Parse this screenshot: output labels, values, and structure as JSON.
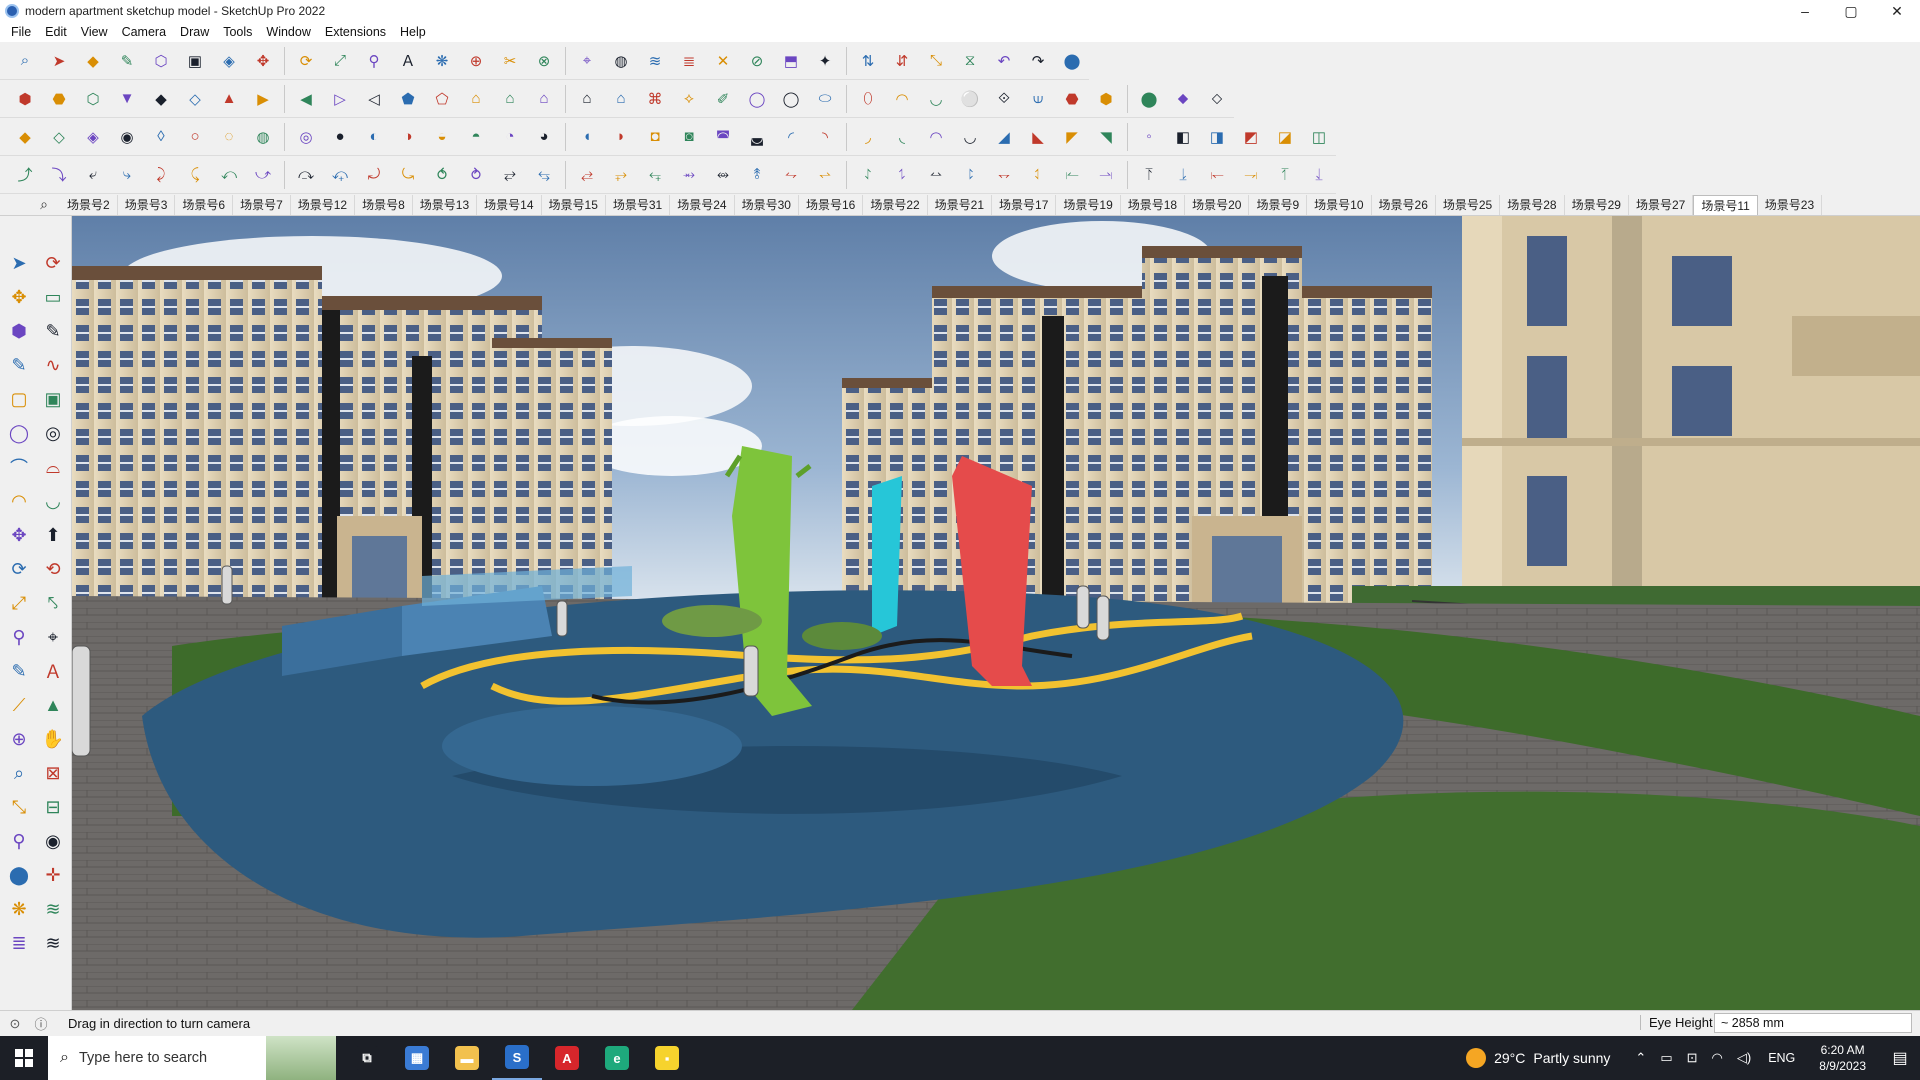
{
  "window": {
    "title": "modern apartment sketchup model - SketchUp Pro 2022",
    "controls": {
      "minimize": "–",
      "maximize": "▢",
      "close": "✕"
    }
  },
  "menu": [
    "File",
    "Edit",
    "View",
    "Camera",
    "Draw",
    "Tools",
    "Window",
    "Extensions",
    "Help"
  ],
  "scenes": {
    "tabs": [
      "场景号2",
      "场景号3",
      "场景号6",
      "场景号7",
      "场景号12",
      "场景号8",
      "场景号13",
      "场景号14",
      "场景号15",
      "场景号31",
      "场景号24",
      "场景号30",
      "场景号16",
      "场景号22",
      "场景号21",
      "场景号17",
      "场景号19",
      "场景号18",
      "场景号20",
      "场景号9",
      "场景号10",
      "场景号26",
      "场景号25",
      "场景号28",
      "场景号29",
      "场景号27",
      "场景号11",
      "场景号23"
    ],
    "active": "场景号11"
  },
  "status": {
    "message": "Drag in direction to turn camera",
    "eye_height_label": "Eye Height",
    "eye_height_value": "~ 2858 mm"
  },
  "taskbar": {
    "search_placeholder": "Type here to search",
    "apps": [
      {
        "name": "task-view",
        "glyph": "⧉",
        "color": "#1c1f26"
      },
      {
        "name": "calculator",
        "glyph": "▦",
        "color": "#3a7bd5"
      },
      {
        "name": "file-explorer",
        "glyph": "▬",
        "color": "#f2c14e"
      },
      {
        "name": "sketchup",
        "glyph": "S",
        "color": "#2a6fc9"
      },
      {
        "name": "acrobat",
        "glyph": "A",
        "color": "#d7262b"
      },
      {
        "name": "edge",
        "glyph": "e",
        "color": "#1ea97c"
      },
      {
        "name": "sticky-notes",
        "glyph": "▪",
        "color": "#f6d32d"
      }
    ],
    "weather": {
      "temp": "29°C",
      "condition": "Partly sunny"
    },
    "language": "ENG",
    "time": "6:20 AM",
    "date": "8/9/2023"
  },
  "colors": {
    "sculpture_green": "#7ec43b",
    "sculpture_cyan": "#26c6d8",
    "sculpture_red": "#e54b4b",
    "plaza_blue": "#2d5a7e",
    "track_yellow": "#f2c230",
    "lawn_green": "#3d6b2a"
  }
}
